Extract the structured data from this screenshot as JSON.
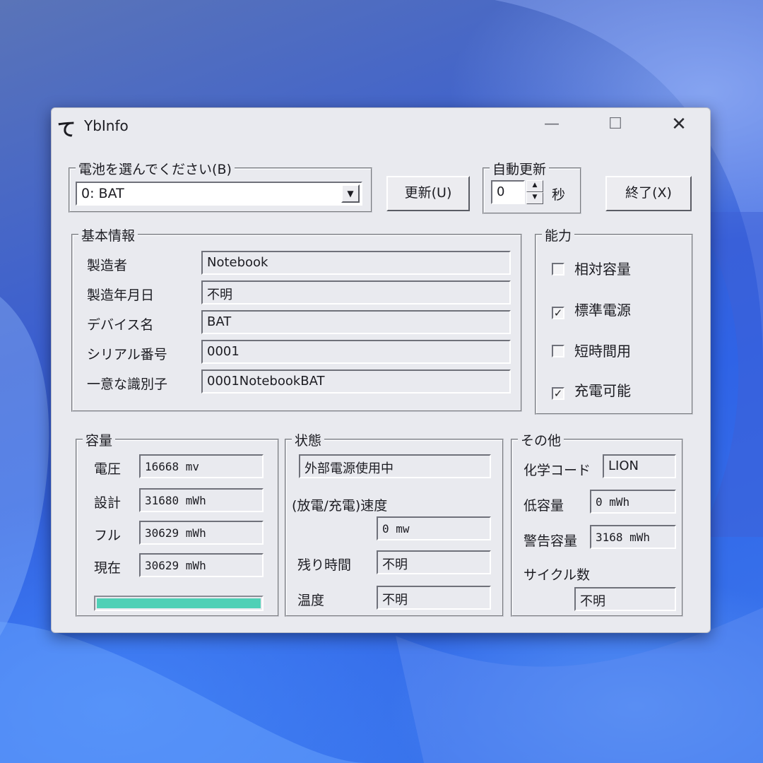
{
  "window": {
    "app_icon": "て",
    "title": "YbInfo",
    "controls": {
      "minimize": "—",
      "maximize": "☐",
      "close": "✕"
    }
  },
  "battery_select": {
    "legend": "電池を選んでください(B)",
    "value": "0: BAT",
    "arrow": "▼"
  },
  "refresh_button": "更新(U)",
  "auto_update": {
    "legend": "自動更新",
    "value": "0",
    "unit": "秒",
    "spin_up": "▲",
    "spin_down": "▼"
  },
  "exit_button": "終了(X)",
  "basic_info": {
    "legend": "基本情報",
    "rows": [
      {
        "label": "製造者",
        "value": "Notebook"
      },
      {
        "label": "製造年月日",
        "value": "不明"
      },
      {
        "label": "デバイス名",
        "value": "BAT"
      },
      {
        "label": "シリアル番号",
        "value": "0001"
      },
      {
        "label": "一意な識別子",
        "value": "0001NotebookBAT"
      }
    ]
  },
  "capability": {
    "legend": "能力",
    "items": [
      {
        "label": "相対容量",
        "checked": false,
        "mark": ""
      },
      {
        "label": "標準電源",
        "checked": true,
        "mark": "✓"
      },
      {
        "label": "短時間用",
        "checked": false,
        "mark": ""
      },
      {
        "label": "充電可能",
        "checked": true,
        "mark": "✓"
      }
    ]
  },
  "capacity": {
    "legend": "容量",
    "rows": [
      {
        "label": "電圧",
        "value": "16668 mv"
      },
      {
        "label": "設計",
        "value": "31680 mWh"
      },
      {
        "label": "フル",
        "value": "30629 mWh"
      },
      {
        "label": "現在",
        "value": "30629 mWh"
      }
    ],
    "charge_fraction": 1.0,
    "bar_color": "#4fd0b6"
  },
  "status": {
    "legend": "状態",
    "power_state": "外部電源使用中",
    "rate_label": "(放電/充電)速度",
    "rate_value": "0 mw",
    "remaining_label": "残り時間",
    "remaining_value": "不明",
    "temp_label": "温度",
    "temp_value": "不明"
  },
  "other": {
    "legend": "その他",
    "chem_label": "化学コード",
    "chem_value": "LION",
    "low_label": "低容量",
    "low_value": "0 mWh",
    "warn_label": "警告容量",
    "warn_value": "3168 mWh",
    "cycle_label": "サイクル数",
    "cycle_value": "不明"
  }
}
